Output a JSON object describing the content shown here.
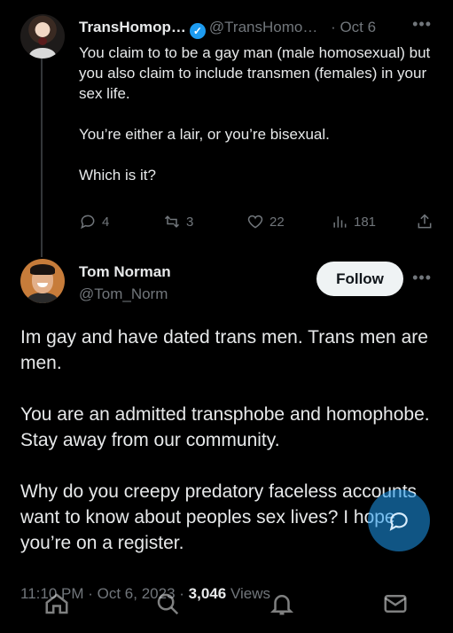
{
  "reply": {
    "display_name": "TransHomop…",
    "handle": "@TransHomo…",
    "date": "· Oct 6",
    "paragraphs": [
      "You claim to to be a gay man (male homosexual) but you also claim to include transmen (females) in your sex life.",
      "You’re either a lair, or you’re bisexual.",
      "Which is it?"
    ],
    "stats": {
      "replies": "4",
      "reposts": "3",
      "likes": "22",
      "views": "181"
    },
    "more": "•••"
  },
  "tweet": {
    "display_name": "Tom Norman",
    "handle": "@Tom_Norm",
    "follow_label": "Follow",
    "more": "•••",
    "paragraphs": [
      "Im gay and have dated trans men. Trans men are men.",
      "You are an admitted transphobe and homophobe. Stay away from our community.",
      "Why do you creepy predatory faceless accounts want to know about peoples sex lives? I hope you’re on a register."
    ],
    "time": "11:10 PM",
    "date": "· Oct 6, 2023 ·",
    "views_count": "3,046",
    "views_label": "Views"
  },
  "icons": {
    "verified": "verified-badge-icon",
    "reply": "reply-icon",
    "repost": "repost-icon",
    "like": "heart-icon",
    "views": "views-icon",
    "share": "share-icon",
    "compose": "compose-icon",
    "nav": [
      "home-icon",
      "search-icon",
      "notifications-icon",
      "messages-icon"
    ]
  },
  "colors": {
    "background": "#000000",
    "accent": "#1d9bf0",
    "muted": "#71767b",
    "text": "#e7e9ea"
  }
}
